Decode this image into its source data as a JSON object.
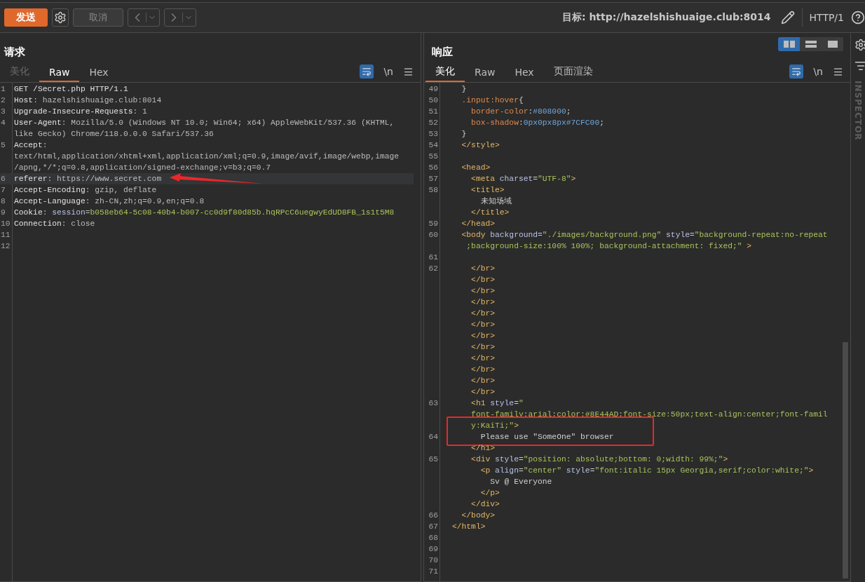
{
  "toolbar": {
    "send": "发送",
    "cancel": "取消",
    "target": "目标: http://hazelshishuaige.club:8014",
    "protocol": "HTTP/1"
  },
  "request": {
    "title": "请求",
    "tabs": [
      {
        "label": "美化",
        "selected": false,
        "disabled": true
      },
      {
        "label": "Raw",
        "selected": true,
        "disabled": false
      },
      {
        "label": "Hex",
        "selected": false,
        "disabled": false
      }
    ],
    "wrap_on": true,
    "newline_toggle": "\\n",
    "lines": [
      {
        "number": "1",
        "segments": [
          {
            "kind": "name",
            "text": "GET /Secret.php HTTP/1.1"
          }
        ]
      },
      {
        "number": "2",
        "segments": [
          {
            "kind": "name",
            "text": "Host"
          },
          {
            "kind": "value",
            "text": ": hazelshishuaige.club:8014"
          }
        ]
      },
      {
        "number": "3",
        "segments": [
          {
            "kind": "name",
            "text": "Upgrade-Insecure-Requests"
          },
          {
            "kind": "value",
            "text": ": 1"
          }
        ]
      },
      {
        "number": "4",
        "segments": [
          {
            "kind": "name",
            "text": "User-Agent"
          },
          {
            "kind": "value",
            "text": ": Mozilla/5.0 (Windows NT 10.0; Win64; x64) AppleWebKit/537.36 (KHTML,"
          }
        ]
      },
      {
        "segments": [
          {
            "kind": "value",
            "text": "like Gecko) Chrome/118.0.0.0 Safari/537.36"
          }
        ]
      },
      {
        "number": "5",
        "segments": [
          {
            "kind": "name",
            "text": "Accept"
          },
          {
            "kind": "value",
            "text": ":"
          }
        ]
      },
      {
        "segments": [
          {
            "kind": "value",
            "text": "text/html,application/xhtml+xml,application/xml;q=0.9,image/avif,image/webp,image"
          }
        ]
      },
      {
        "segments": [
          {
            "kind": "value",
            "text": "/apng,*/*;q=0.8,application/signed-exchange;v=b3;q=0.7"
          }
        ]
      },
      {
        "number": "6",
        "highlighted": true,
        "arrow": true,
        "segments": [
          {
            "kind": "name",
            "text": "referer"
          },
          {
            "kind": "value",
            "text": ": https://www.secret.com"
          }
        ]
      },
      {
        "number": "7",
        "segments": [
          {
            "kind": "name",
            "text": "Accept-Encoding"
          },
          {
            "kind": "value",
            "text": ": gzip, deflate"
          }
        ]
      },
      {
        "number": "8",
        "segments": [
          {
            "kind": "name",
            "text": "Accept-Language"
          },
          {
            "kind": "value",
            "text": ": zh-CN,zh;q=0.9,en;q=0.8"
          }
        ]
      },
      {
        "number": "9",
        "segments": [
          {
            "kind": "name",
            "text": "Cookie"
          },
          {
            "kind": "value",
            "text": ": "
          },
          {
            "kind": "attr",
            "text": "session"
          },
          {
            "kind": "value",
            "text": "="
          },
          {
            "kind": "string",
            "text": "b058eb64-5c08-40b4-b007-cc0d9f80d85b.hqRPcC6uegwyEdUD8FB_1s1t5M8"
          }
        ]
      },
      {
        "number": "10",
        "segments": [
          {
            "kind": "name",
            "text": "Connection"
          },
          {
            "kind": "value",
            "text": ": close"
          }
        ]
      },
      {
        "number": "11"
      },
      {
        "number": "12"
      }
    ]
  },
  "response": {
    "title": "响应",
    "layout_modes": [
      {
        "kind": "columns",
        "selected": true
      },
      {
        "kind": "rows",
        "selected": false
      },
      {
        "kind": "single",
        "selected": false
      }
    ],
    "tabs": [
      {
        "label": "美化",
        "selected": true,
        "disabled": false
      },
      {
        "label": "Raw",
        "selected": false,
        "disabled": false
      },
      {
        "label": "Hex",
        "selected": false,
        "disabled": false
      },
      {
        "label": "页面渲染",
        "selected": false,
        "disabled": false
      }
    ],
    "wrap_on": true,
    "newline_toggle": "\\n",
    "lines": [
      {
        "number": "49",
        "segments": [
          {
            "kind": "punct",
            "text": "  }"
          }
        ]
      },
      {
        "number": "50",
        "segments": [
          {
            "kind": "selector",
            "text": "  .input:hover"
          },
          {
            "kind": "punct",
            "text": "{"
          }
        ]
      },
      {
        "number": "51",
        "segments": [
          {
            "kind": "selector",
            "text": "    border-color"
          },
          {
            "kind": "punct",
            "text": ":"
          },
          {
            "kind": "number",
            "text": "#808000"
          },
          {
            "kind": "punct",
            "text": ";"
          }
        ]
      },
      {
        "number": "52",
        "segments": [
          {
            "kind": "selector",
            "text": "    box-shadow"
          },
          {
            "kind": "punct",
            "text": ":"
          },
          {
            "kind": "number",
            "text": "0px0px8px#7CFC00"
          },
          {
            "kind": "punct",
            "text": ";"
          }
        ]
      },
      {
        "number": "53",
        "segments": [
          {
            "kind": "punct",
            "text": "  }"
          }
        ]
      },
      {
        "number": "54",
        "segments": [
          {
            "kind": "tag",
            "text": "  </style>"
          }
        ]
      },
      {
        "number": "55"
      },
      {
        "number": "56",
        "segments": [
          {
            "kind": "tag",
            "text": "  <head>"
          }
        ]
      },
      {
        "number": "57",
        "segments": [
          {
            "kind": "tag",
            "text": "    <meta"
          },
          {
            "kind": "attr",
            "text": " charset"
          },
          {
            "kind": "punct",
            "text": "="
          },
          {
            "kind": "string",
            "text": "\"UTF-8\""
          },
          {
            "kind": "tag",
            "text": ">"
          }
        ]
      },
      {
        "number": "58",
        "segments": [
          {
            "kind": "tag",
            "text": "    <title>"
          }
        ]
      },
      {
        "segments": [
          {
            "kind": "text",
            "text": "      未知场域"
          }
        ]
      },
      {
        "segments": [
          {
            "kind": "tag",
            "text": "    </title>"
          }
        ]
      },
      {
        "number": "59",
        "segments": [
          {
            "kind": "tag",
            "text": "  </head>"
          }
        ]
      },
      {
        "number": "60",
        "segments": [
          {
            "kind": "tag",
            "text": "  <body"
          },
          {
            "kind": "attr",
            "text": " background"
          },
          {
            "kind": "punct",
            "text": "="
          },
          {
            "kind": "string",
            "text": "\"./images/background.png\""
          },
          {
            "kind": "attr",
            "text": " style"
          },
          {
            "kind": "punct",
            "text": "="
          },
          {
            "kind": "string",
            "text": "\"background-repeat:no-repeat"
          }
        ]
      },
      {
        "segments": [
          {
            "kind": "string",
            "text": "   ;background-size:100% 100%; background-attachment: fixed;\""
          },
          {
            "kind": "tag",
            "text": " >"
          }
        ]
      },
      {
        "number": "61"
      },
      {
        "number": "62",
        "segments": [
          {
            "kind": "tag",
            "text": "    </br>"
          }
        ]
      },
      {
        "segments": [
          {
            "kind": "tag",
            "text": "    </br>"
          }
        ]
      },
      {
        "segments": [
          {
            "kind": "tag",
            "text": "    </br>"
          }
        ]
      },
      {
        "segments": [
          {
            "kind": "tag",
            "text": "    </br>"
          }
        ]
      },
      {
        "segments": [
          {
            "kind": "tag",
            "text": "    </br>"
          }
        ]
      },
      {
        "segments": [
          {
            "kind": "tag",
            "text": "    </br>"
          }
        ]
      },
      {
        "segments": [
          {
            "kind": "tag",
            "text": "    </br>"
          }
        ]
      },
      {
        "segments": [
          {
            "kind": "tag",
            "text": "    </br>"
          }
        ]
      },
      {
        "segments": [
          {
            "kind": "tag",
            "text": "    </br>"
          }
        ]
      },
      {
        "segments": [
          {
            "kind": "tag",
            "text": "    </br>"
          }
        ]
      },
      {
        "segments": [
          {
            "kind": "tag",
            "text": "    </br>"
          }
        ]
      },
      {
        "segments": [
          {
            "kind": "tag",
            "text": "    </br>"
          }
        ]
      },
      {
        "number": "63",
        "segments": [
          {
            "kind": "tag",
            "text": "    <h1"
          },
          {
            "kind": "attr",
            "text": " style"
          },
          {
            "kind": "punct",
            "text": "="
          },
          {
            "kind": "string",
            "text": "\""
          }
        ]
      },
      {
        "segments": [
          {
            "kind": "string",
            "text": "    font-family:arial;color:#8E44AD;font-size:50px;text-align:center;font-famil"
          }
        ]
      },
      {
        "boxed": true,
        "segments": [
          {
            "kind": "string",
            "text": "    y:KaiTi;\""
          },
          {
            "kind": "tag",
            "text": ">"
          }
        ]
      },
      {
        "number": "64",
        "boxed": true,
        "segments": [
          {
            "kind": "text",
            "text": "      Please use \"SomeOne\" browser"
          }
        ]
      },
      {
        "segments": [
          {
            "kind": "tag",
            "text": "    </h1>"
          }
        ]
      },
      {
        "number": "65",
        "segments": [
          {
            "kind": "tag",
            "text": "    <div"
          },
          {
            "kind": "attr",
            "text": " style"
          },
          {
            "kind": "punct",
            "text": "="
          },
          {
            "kind": "string",
            "text": "\"position: absolute;bottom: 0;width: 99%;\""
          },
          {
            "kind": "tag",
            "text": ">"
          }
        ]
      },
      {
        "segments": [
          {
            "kind": "tag",
            "text": "      <p"
          },
          {
            "kind": "attr",
            "text": " align"
          },
          {
            "kind": "punct",
            "text": "="
          },
          {
            "kind": "string",
            "text": "\"center\""
          },
          {
            "kind": "attr",
            "text": " style"
          },
          {
            "kind": "punct",
            "text": "="
          },
          {
            "kind": "string",
            "text": "\"font:italic 15px Georgia,serif;color:white;\""
          },
          {
            "kind": "tag",
            "text": ">"
          }
        ]
      },
      {
        "segments": [
          {
            "kind": "text",
            "text": "        Sv @ Everyone"
          }
        ]
      },
      {
        "segments": [
          {
            "kind": "tag",
            "text": "      </p>"
          }
        ]
      },
      {
        "segments": [
          {
            "kind": "tag",
            "text": "    </div>"
          }
        ]
      },
      {
        "number": "66",
        "segments": [
          {
            "kind": "tag",
            "text": "  </body>"
          }
        ]
      },
      {
        "number": "67",
        "segments": [
          {
            "kind": "tag",
            "text": "</html>"
          }
        ]
      },
      {
        "number": "68"
      },
      {
        "number": "69"
      },
      {
        "number": "70"
      },
      {
        "number": "71"
      }
    ]
  },
  "inspector": {
    "title": "INSPECTOR"
  }
}
